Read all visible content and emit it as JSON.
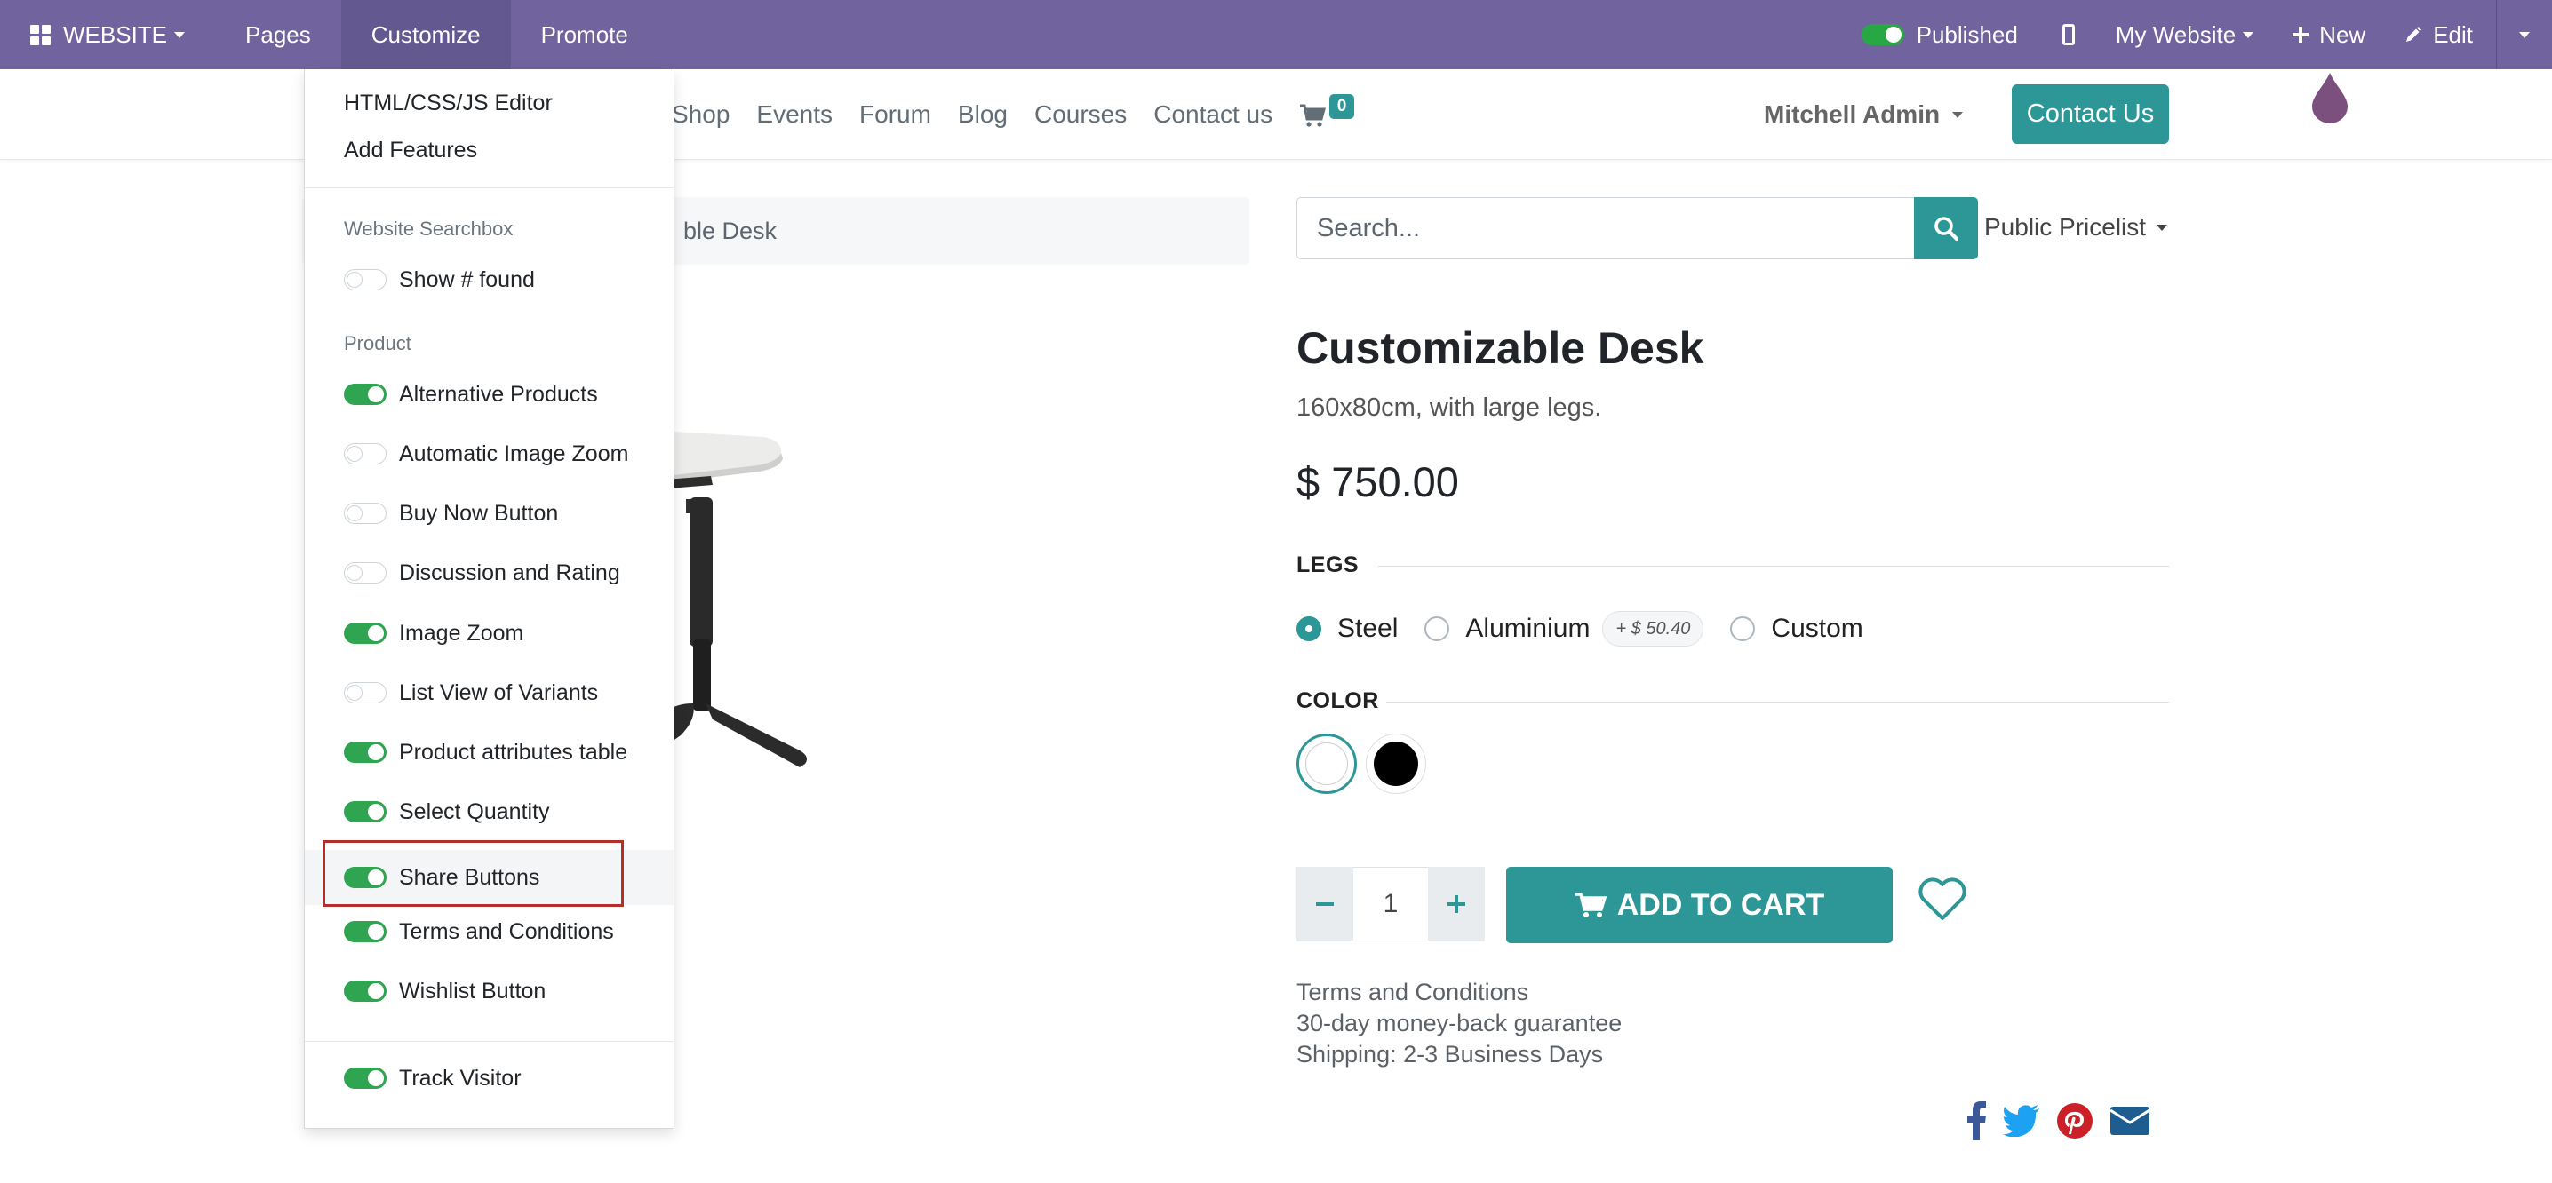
{
  "topbar": {
    "website_label": "WEBSITE",
    "pages_label": "Pages",
    "customize_label": "Customize",
    "promote_label": "Promote",
    "published_label": "Published",
    "my_website_label": "My Website",
    "new_label": "New",
    "edit_label": "Edit"
  },
  "header": {
    "nav": [
      "Shop",
      "Events",
      "Forum",
      "Blog",
      "Courses",
      "Contact us"
    ],
    "cart_count": "0",
    "user_name": "Mitchell Admin",
    "contact_button": "Contact Us"
  },
  "breadcrumb": {
    "current_fragment": "ble Desk"
  },
  "search": {
    "placeholder": "Search...",
    "pricelist": "Public Pricelist"
  },
  "product": {
    "title": "Customizable Desk",
    "description": "160x80cm, with large legs.",
    "price": "$ 750.00",
    "legs_label": "LEGS",
    "legs_options": [
      {
        "label": "Steel",
        "checked": true
      },
      {
        "label": "Aluminium",
        "checked": false,
        "extra": "+ $ 50.40"
      },
      {
        "label": "Custom",
        "checked": false
      }
    ],
    "color_label": "COLOR",
    "colors": [
      {
        "hex": "#ffffff",
        "selected": true
      },
      {
        "hex": "#000000",
        "selected": false
      }
    ],
    "quantity": "1",
    "add_to_cart": "ADD TO CART",
    "terms_lines": [
      "Terms and Conditions",
      "30-day money-back guarantee",
      "Shipping: 2-3 Business Days"
    ],
    "share_icons": [
      "facebook-icon",
      "twitter-icon",
      "pinterest-icon",
      "envelope-icon"
    ]
  },
  "customize_menu": {
    "links": [
      "HTML/CSS/JS Editor",
      "Add Features"
    ],
    "searchbox_header": "Website Searchbox",
    "searchbox_items": [
      {
        "label": "Show # found",
        "on": false
      }
    ],
    "product_header": "Product",
    "product_items": [
      {
        "label": "Alternative Products",
        "on": true
      },
      {
        "label": "Automatic Image Zoom",
        "on": false
      },
      {
        "label": "Buy Now Button",
        "on": false
      },
      {
        "label": "Discussion and Rating",
        "on": false
      },
      {
        "label": "Image Zoom",
        "on": true
      },
      {
        "label": "List View of Variants",
        "on": false
      },
      {
        "label": "Product attributes table",
        "on": true
      },
      {
        "label": "Select Quantity",
        "on": true
      },
      {
        "label": "Share Buttons",
        "on": true
      },
      {
        "label": "Terms and Conditions",
        "on": true
      },
      {
        "label": "Wishlist Button",
        "on": true
      }
    ],
    "footer_items": [
      {
        "label": "Track Visitor",
        "on": true
      }
    ]
  },
  "colors": {
    "topbar": "#71639e",
    "primary": "#2c9796",
    "toggle_on": "#2fa551",
    "highlight": "#b3302a"
  }
}
